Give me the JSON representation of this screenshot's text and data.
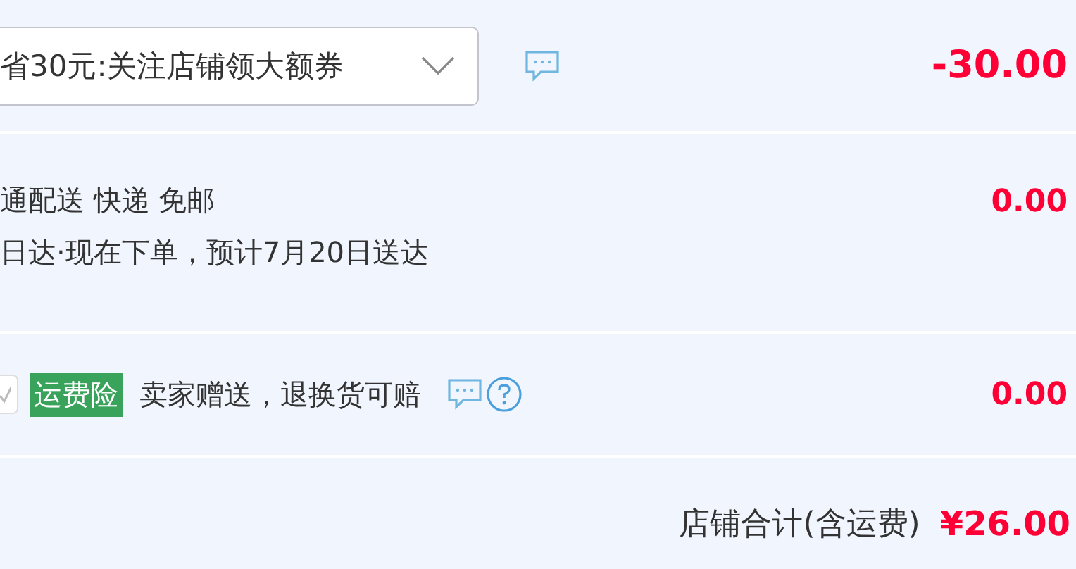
{
  "coupon": {
    "value": "省30元:关注店铺领大额券",
    "amount": "-30.00"
  },
  "delivery": {
    "lines": [
      "通配送 快递 免邮",
      "日达·现在下单，预计7月20日送达"
    ],
    "amount": "0.00"
  },
  "insurance": {
    "checked": true,
    "tag": "运费险",
    "text": "卖家赠送，退换货可赔",
    "amount": "0.00"
  },
  "total": {
    "label": "店铺合计(含运费)",
    "amount": "¥26.00"
  }
}
